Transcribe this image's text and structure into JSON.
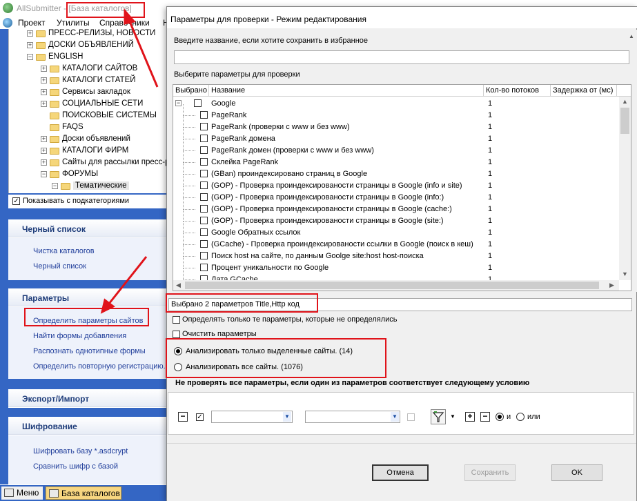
{
  "app": {
    "name": "AllSubmitter",
    "title_sep": " - ",
    "doc_title": "[База каталогов]",
    "menu": [
      "Проект",
      "Утилиты",
      "Справочники",
      "Н"
    ]
  },
  "tree": {
    "items": [
      {
        "label": "ПРЕСС-РЕЛИЗЫ, НОВОСТИ",
        "level": 1,
        "box": "+"
      },
      {
        "label": "ДОСКИ ОБЪЯВЛЕНИЙ",
        "level": 1,
        "box": "+"
      },
      {
        "label": "ENGLISH",
        "level": 1,
        "box": "−"
      },
      {
        "label": "КАТАЛОГИ САЙТОВ",
        "level": 2,
        "box": "+"
      },
      {
        "label": "КАТАЛОГИ СТАТЕЙ",
        "level": 2,
        "box": "+"
      },
      {
        "label": "Сервисы закладок",
        "level": 2,
        "box": "+"
      },
      {
        "label": "СОЦИАЛЬНЫЕ СЕТИ",
        "level": 2,
        "box": "+"
      },
      {
        "label": "ПОИСКОВЫЕ СИСТЕМЫ",
        "level": 2,
        "box": ""
      },
      {
        "label": "FAQS",
        "level": 2,
        "box": ""
      },
      {
        "label": "Доски объявлений",
        "level": 2,
        "box": "+"
      },
      {
        "label": "КАТАЛОГИ ФИРМ",
        "level": 2,
        "box": "+"
      },
      {
        "label": "Сайты для рассылки пресс-р",
        "level": 2,
        "box": "+"
      },
      {
        "label": "ФОРУМЫ",
        "level": 2,
        "box": "−"
      },
      {
        "label": "Тематические",
        "level": 3,
        "box": "−",
        "selected": true
      }
    ],
    "show_sub_label": "Показывать с подкатегориями",
    "show_sub_checked": "✓"
  },
  "panels": {
    "blacklist": {
      "title": "Черный список",
      "links": [
        "Чистка каталогов",
        "Черный список"
      ]
    },
    "params": {
      "title": "Параметры",
      "links": [
        "Определить параметры сайтов",
        "Найти формы добавления",
        "Распознать однотипные формы",
        "Определить повторную регистрацию."
      ]
    },
    "export": {
      "title": "Экспорт/Импорт"
    },
    "crypt": {
      "title": "Шифрование",
      "links": [
        "Шифровать базу *.asdcrypt",
        "Сравнить шифр с базой"
      ]
    }
  },
  "taskbar": {
    "menu": "Меню",
    "active": "База каталогов"
  },
  "dialog": {
    "title": "Параметры для проверки - Режим редактирования",
    "fav_label": "Введите название, если хотите сохранить в избранное",
    "fav_value": "",
    "choose_label": "Выберите параметры для проверки",
    "columns": [
      "Выбрано",
      "Название",
      "Кол-во потоков",
      "Задержка от (мс)"
    ],
    "rows": [
      {
        "name": "Google",
        "threads": "1",
        "group": true
      },
      {
        "name": "PageRank",
        "threads": "1"
      },
      {
        "name": "PageRank (проверки с www и без www)",
        "threads": "1"
      },
      {
        "name": "PageRank домена",
        "threads": "1"
      },
      {
        "name": "PageRank домен (проверки с www и без www)",
        "threads": "1"
      },
      {
        "name": "Склейка PageRank",
        "threads": "1"
      },
      {
        "name": "(GBan) проиндексировано страниц в Google",
        "threads": "1"
      },
      {
        "name": "(GOP) - Проверка проиндексированости страницы в Google (info и site)",
        "threads": "1"
      },
      {
        "name": "(GOP) - Проверка проиндексированости страницы в Google (info:)",
        "threads": "1"
      },
      {
        "name": "(GOP) - Проверка проиндексированости страницы в Google (cache:)",
        "threads": "1"
      },
      {
        "name": "(GOP) - Проверка проиндексированости страницы в Google (site:)",
        "threads": "1"
      },
      {
        "name": "Google Обратных ссылок",
        "threads": "1"
      },
      {
        "name": "(GCache) - Проверка проиндексированости ссылки в Google (поиск в кеш)",
        "threads": "1"
      },
      {
        "name": "Поиск host на сайте, по данным Goolge site:host host-поиска",
        "threads": "1"
      },
      {
        "name": "Процент уникальности по Google",
        "threads": "1"
      },
      {
        "name": "Дата GCache",
        "threads": "1"
      }
    ],
    "summary": "Выбрано 2 параметров  Title,Http код",
    "only_undefined_label": "Определять только те параметры, которые не определялись",
    "clear_label": "Очистить параметры",
    "radio_selected_label": "Анализировать только выделенные сайты. (14)",
    "radio_all_label": "Анализировать все сайты. (1076)",
    "condition_title": "Не проверять все параметры, если один из параметров соответствует следующему условию",
    "filter": {
      "and_label": "и",
      "or_label": "или",
      "combo1": "",
      "combo2": "",
      "checked": "✓"
    },
    "buttons": {
      "cancel": "Отмена",
      "save": "Сохранить",
      "ok": "OK"
    }
  },
  "colors": {
    "accent_blue": "#3466c4",
    "annotation_red": "#e0131a"
  }
}
